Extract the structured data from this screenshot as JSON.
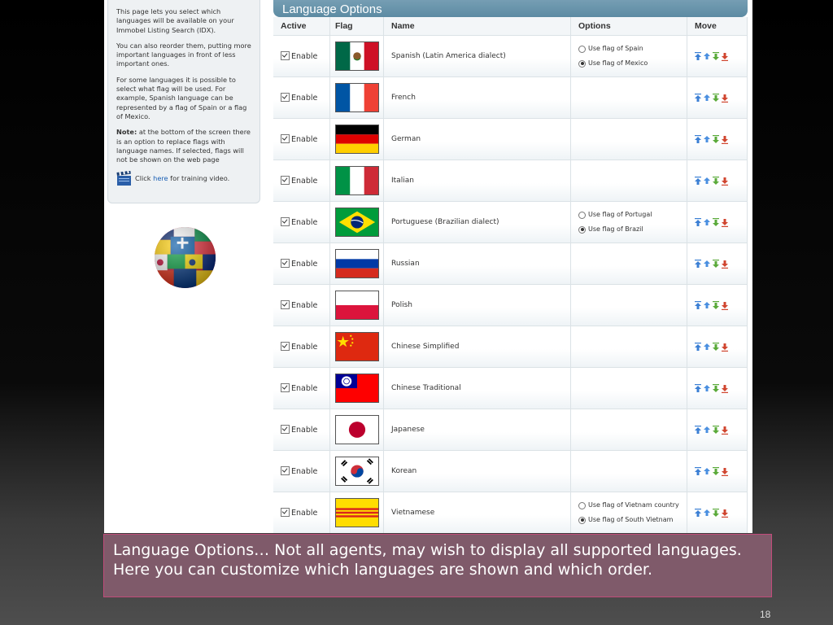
{
  "help": {
    "p1": "This page lets you select which languages will be available on your Immobel Listing Search (IDX).",
    "p2": "You can also reorder them, putting more important languages in front of less important ones.",
    "p3": "For some languages it is possible to select what flag will be used. For example, Spanish language can be represented by a flag of Spain or a flag of Mexico.",
    "note_label": "Note:",
    "note_text": " at the bottom of the screen there is an option to replace flags with language names. If selected, flags will not be shown on the web page",
    "video_prefix": "Click ",
    "video_link": "here",
    "video_suffix": " for training video."
  },
  "panel": {
    "title": "Language Options",
    "columns": {
      "active": "Active",
      "flag": "Flag",
      "name": "Name",
      "options": "Options",
      "move": "Move"
    },
    "enable_label": "Enable",
    "rows": [
      {
        "key": "spanish",
        "name": "Spanish (Latin America dialect)",
        "flag": "mexico",
        "options": [
          {
            "label": "Use flag of Spain",
            "selected": false
          },
          {
            "label": "Use flag of Mexico",
            "selected": true
          }
        ]
      },
      {
        "key": "french",
        "name": "French",
        "flag": "france",
        "options": []
      },
      {
        "key": "german",
        "name": "German",
        "flag": "germany",
        "options": []
      },
      {
        "key": "italian",
        "name": "Italian",
        "flag": "italy",
        "options": []
      },
      {
        "key": "portuguese",
        "name": "Portuguese (Brazilian dialect)",
        "flag": "brazil",
        "options": [
          {
            "label": "Use flag of Portugal",
            "selected": false
          },
          {
            "label": "Use flag of Brazil",
            "selected": true
          }
        ]
      },
      {
        "key": "russian",
        "name": "Russian",
        "flag": "russia",
        "options": []
      },
      {
        "key": "polish",
        "name": "Polish",
        "flag": "poland",
        "options": []
      },
      {
        "key": "chinese-simplified",
        "name": "Chinese Simplified",
        "flag": "china",
        "options": []
      },
      {
        "key": "chinese-traditional",
        "name": "Chinese Traditional",
        "flag": "taiwan",
        "options": []
      },
      {
        "key": "japanese",
        "name": "Japanese",
        "flag": "japan",
        "options": []
      },
      {
        "key": "korean",
        "name": "Korean",
        "flag": "korea",
        "options": []
      },
      {
        "key": "vietnamese",
        "name": "Vietnamese",
        "flag": "south-vietnam",
        "options": [
          {
            "label": "Use flag of Vietnam country",
            "selected": false
          },
          {
            "label": "Use flag of South Vietnam",
            "selected": true
          }
        ]
      }
    ]
  },
  "caption": {
    "line1": "Language Options… Not all agents, may wish to display all supported languages.",
    "line2": "Here you can customize which languages are shown and which order."
  },
  "slide_number": "18",
  "colors": {
    "header": "#6a96ad",
    "caption_bg": "#7f5a6a",
    "caption_border": "#c14b7a",
    "move_up": "#3b7fd4",
    "move_top": "#5aaa3a",
    "move_bottom": "#d0452f"
  }
}
